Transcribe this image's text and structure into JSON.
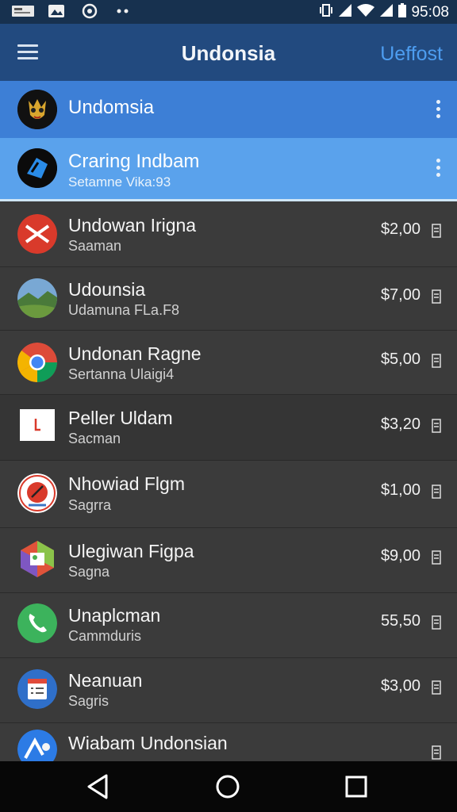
{
  "status_bar": {
    "time": "95:08",
    "left_icons": [
      "notification-badge-icon",
      "image-icon",
      "sync-icon",
      "more-dots-icon"
    ],
    "right_icons": [
      "vibrate-icon",
      "signal-icon",
      "wifi-icon",
      "signal-icon",
      "battery-icon"
    ]
  },
  "app_bar": {
    "title": "Undonsia",
    "action_label": "Ueffost"
  },
  "selected_items": [
    {
      "title": "Undomsia",
      "icon": "character-face-icon"
    },
    {
      "title": "Craring Indbam",
      "subtitle": "Setamne Vika:93",
      "icon": "blue-arrow-icon"
    }
  ],
  "list_items": [
    {
      "title": "Undowan Irigna",
      "subtitle": "Saaman",
      "price": "$2,00",
      "icon": "red-x-icon"
    },
    {
      "title": "Udounsia",
      "subtitle": "Udamuna FLa.F8",
      "price": "$7,00",
      "icon": "landscape-photo-icon"
    },
    {
      "title": "Undonan Ragne",
      "subtitle": "Sertanna Ulaigi4",
      "price": "$5,00",
      "icon": "chrome-icon"
    },
    {
      "title": "Peller Uldam",
      "subtitle": "Sacman",
      "price": "$3,20",
      "icon": "document-icon"
    },
    {
      "title": "Nhowiad Flgm",
      "subtitle": "Sagrra",
      "price": "$1,00",
      "icon": "pinwheel-icon"
    },
    {
      "title": "Ulegiwan Figpa",
      "subtitle": "Sagna",
      "price": "$9,00",
      "icon": "hexagon-app-icon"
    },
    {
      "title": "Unaplcman",
      "subtitle": "Cammduris",
      "price": "55,50",
      "icon": "phone-icon"
    },
    {
      "title": "Neanuan",
      "subtitle": "Sagris",
      "price": "$3,00",
      "icon": "calendar-list-icon"
    },
    {
      "title": "Wiabam Undonsian",
      "subtitle": "",
      "price": "",
      "icon": "blue-app-icon"
    }
  ],
  "colors": {
    "status_bar": "#17314f",
    "app_bar": "#224a7f",
    "selected_primary": "#3d7fd6",
    "selected_secondary": "#5aa2ec",
    "list_background": "#3a3a3a",
    "accent": "#4d9df0"
  }
}
